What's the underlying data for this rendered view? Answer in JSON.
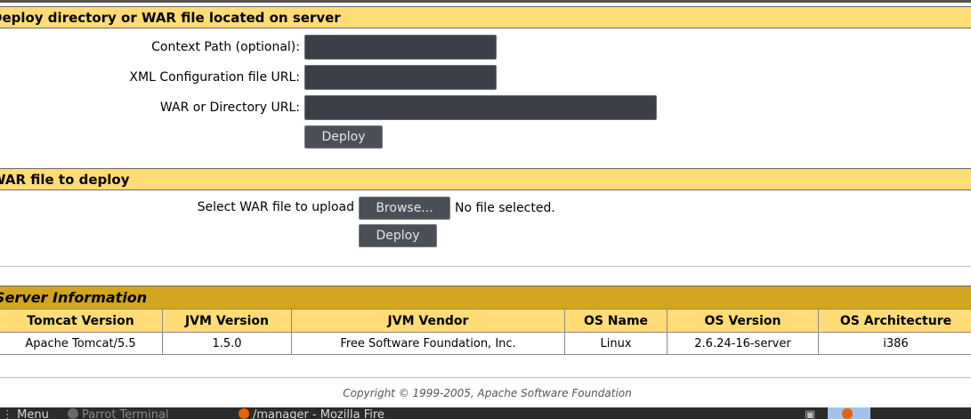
{
  "deploy_dir": {
    "title": "Deploy directory or WAR file located on server",
    "context_path_label": "Context Path (optional):",
    "context_path_value": "",
    "xml_config_label": "XML Configuration file URL:",
    "xml_config_value": "",
    "war_dir_label": "WAR or Directory URL:",
    "war_dir_value": "",
    "deploy_button": "Deploy"
  },
  "war_upload": {
    "title": "WAR file to deploy",
    "select_label": "Select WAR file to upload",
    "browse_button": "Browse...",
    "file_status": "No file selected.",
    "deploy_button": "Deploy"
  },
  "server_info": {
    "title": "Server Information",
    "headers": [
      "Tomcat Version",
      "JVM Version",
      "JVM Vendor",
      "OS Name",
      "OS Version",
      "OS Architecture"
    ],
    "row": [
      "Apache Tomcat/5.5",
      "1.5.0",
      "Free Software Foundation, Inc.",
      "Linux",
      "2.6.24-16-server",
      "i386"
    ]
  },
  "footer": {
    "copyright": "Copyright © 1999-2005, Apache Software Foundation"
  },
  "taskbar": {
    "items": [
      "Menu",
      "Parrot Terminal",
      "/manager - Mozilla Fire"
    ]
  },
  "colors": {
    "section_bar": "#ffdc75",
    "server_bar": "#d4a41f",
    "field_bg": "#3c3f47",
    "button_bg": "#4b4f58"
  }
}
